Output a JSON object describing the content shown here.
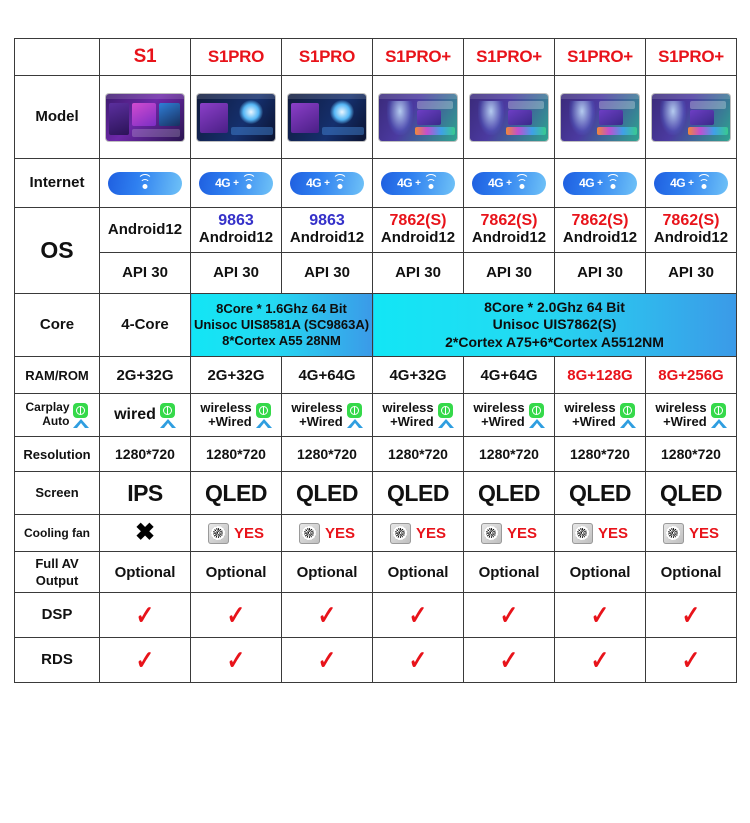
{
  "table": {
    "columns": [
      {
        "name": "S1"
      },
      {
        "name": "S1PRO"
      },
      {
        "name": "S1PRO"
      },
      {
        "name": "S1PRO+"
      },
      {
        "name": "S1PRO+"
      },
      {
        "name": "S1PRO+"
      },
      {
        "name": "S1PRO+"
      }
    ],
    "rows": {
      "model": {
        "label": "Model",
        "devices": [
          "s1",
          "s1pro",
          "s1pro",
          "s1proplus",
          "s1proplus",
          "s1proplus",
          "s1proplus"
        ]
      },
      "internet": {
        "label": "Internet",
        "values": [
          {
            "has4g": false,
            "wifi": true
          },
          {
            "has4g": true,
            "wifi": true,
            "text4g": "4G",
            "plus": "+"
          },
          {
            "has4g": true,
            "wifi": true,
            "text4g": "4G",
            "plus": "+"
          },
          {
            "has4g": true,
            "wifi": true,
            "text4g": "4G",
            "plus": "+"
          },
          {
            "has4g": true,
            "wifi": true,
            "text4g": "4G",
            "plus": "+"
          },
          {
            "has4g": true,
            "wifi": true,
            "text4g": "4G",
            "plus": "+"
          },
          {
            "has4g": true,
            "wifi": true,
            "text4g": "4G",
            "plus": "+"
          }
        ]
      },
      "os": {
        "label": "OS",
        "chips": [
          "",
          "9863",
          "9863",
          "7862(S)",
          "7862(S)",
          "7862(S)",
          "7862(S)"
        ],
        "chip_colors": [
          "",
          "blue",
          "blue",
          "red",
          "red",
          "red",
          "red"
        ],
        "android": [
          "Android12",
          "Android12",
          "Android12",
          "Android12",
          "Android12",
          "Android12",
          "Android12"
        ],
        "api": [
          "API 30",
          "API 30",
          "API 30",
          "API 30",
          "API 30",
          "API 30",
          "API 30"
        ]
      },
      "core": {
        "label": "Core",
        "col1": "4-Core",
        "group_a": "8Core * 1.6Ghz 64 Bit\nUnisoc UIS8581A (SC9863A)\n8*Cortex A55 28NM",
        "group_a_lines": [
          "8Core * 1.6Ghz 64 Bit",
          "Unisoc UIS8581A (SC9863A)",
          "8*Cortex A55 28NM"
        ],
        "group_b_lines": [
          "8Core * 2.0Ghz 64 Bit",
          "Unisoc UIS7862(S)",
          "2*Cortex A75+6*Cortex A5512NM"
        ]
      },
      "ram_rom": {
        "label": "RAM/ROM",
        "values": [
          "2G+32G",
          "2G+32G",
          "4G+64G",
          "4G+32G",
          "4G+64G",
          "8G+128G",
          "8G+256G"
        ],
        "highlight": [
          false,
          false,
          false,
          false,
          false,
          true,
          true
        ]
      },
      "carplay": {
        "label_line1": "Carplay",
        "label_line2": "Auto",
        "values": [
          {
            "line1": "wired",
            "line2": ""
          },
          {
            "line1": "wireless",
            "line2": "+Wired"
          },
          {
            "line1": "wireless",
            "line2": "+Wired"
          },
          {
            "line1": "wireless",
            "line2": "+Wired"
          },
          {
            "line1": "wireless",
            "line2": "+Wired"
          },
          {
            "line1": "wireless",
            "line2": "+Wired"
          },
          {
            "line1": "wireless",
            "line2": "+Wired"
          }
        ]
      },
      "resolution": {
        "label": "Resolution",
        "values": [
          "1280*720",
          "1280*720",
          "1280*720",
          "1280*720",
          "1280*720",
          "1280*720",
          "1280*720"
        ]
      },
      "screen": {
        "label": "Screen",
        "values": [
          "IPS",
          "QLED",
          "QLED",
          "QLED",
          "QLED",
          "QLED",
          "QLED"
        ]
      },
      "cooling_fan": {
        "label": "Cooling fan",
        "values": [
          {
            "type": "cross",
            "text": "✖"
          },
          {
            "type": "fan",
            "text": "YES"
          },
          {
            "type": "fan",
            "text": "YES"
          },
          {
            "type": "fan",
            "text": "YES"
          },
          {
            "type": "fan",
            "text": "YES"
          },
          {
            "type": "fan",
            "text": "YES"
          },
          {
            "type": "fan",
            "text": "YES"
          }
        ]
      },
      "full_av": {
        "label_line1": "Full  AV",
        "label_line2": "Output",
        "values": [
          "Optional",
          "Optional",
          "Optional",
          "Optional",
          "Optional",
          "Optional",
          "Optional"
        ]
      },
      "dsp": {
        "label": "DSP",
        "values": [
          "✓",
          "✓",
          "✓",
          "✓",
          "✓",
          "✓",
          "✓"
        ]
      },
      "rds": {
        "label": "RDS",
        "values": [
          "✓",
          "✓",
          "✓",
          "✓",
          "✓",
          "✓",
          "✓"
        ]
      }
    }
  },
  "colors": {
    "model_red": "#e8131a",
    "chip_blue": "#3531c9",
    "core_cyan": "#12e6f5",
    "core_blue": "#3b9ae8",
    "carplay_green": "#35d94a",
    "android_auto_blue": "#2f9ee0"
  }
}
